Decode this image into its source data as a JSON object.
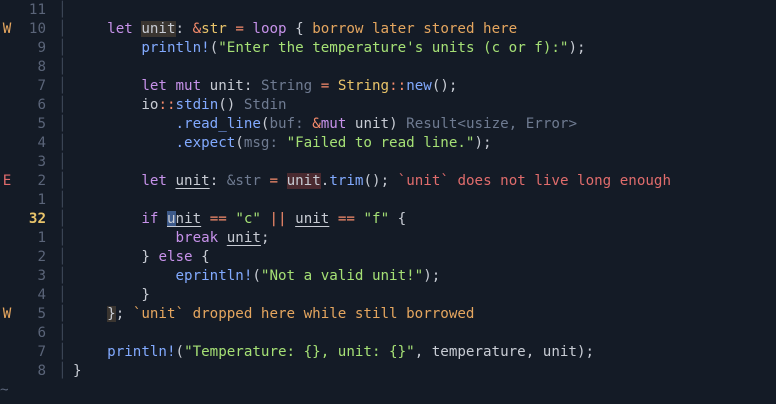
{
  "editor": {
    "lines": [
      {
        "num": "11",
        "diag": "",
        "cur": false,
        "tokens": []
      },
      {
        "num": "10",
        "diag": "W",
        "cur": false,
        "tokens": [
          {
            "t": "    "
          },
          {
            "t": "let",
            "c": "kw"
          },
          {
            "t": " "
          },
          {
            "t": "unit",
            "c": "var hl-w"
          },
          {
            "t": ": ",
            "c": "punct"
          },
          {
            "t": "&",
            "c": "op"
          },
          {
            "t": "str",
            "c": "ty"
          },
          {
            "t": " "
          },
          {
            "t": "=",
            "c": "op"
          },
          {
            "t": " "
          },
          {
            "t": "loop",
            "c": "kw"
          },
          {
            "t": " { ",
            "c": "punct"
          },
          {
            "t": "borrow later stored here",
            "c": "warn"
          }
        ]
      },
      {
        "num": "9",
        "diag": "",
        "cur": false,
        "tokens": [
          {
            "t": "        "
          },
          {
            "t": "println!",
            "c": "fn"
          },
          {
            "t": "(",
            "c": "punct"
          },
          {
            "t": "\"Enter the temperature's units (c or f):\"",
            "c": "str"
          },
          {
            "t": ");",
            "c": "punct"
          }
        ]
      },
      {
        "num": "8",
        "diag": "",
        "cur": false,
        "tokens": []
      },
      {
        "num": "7",
        "diag": "",
        "cur": false,
        "tokens": [
          {
            "t": "        "
          },
          {
            "t": "let",
            "c": "kw"
          },
          {
            "t": " "
          },
          {
            "t": "mut",
            "c": "kw"
          },
          {
            "t": " unit",
            "c": "var"
          },
          {
            "t": ": ",
            "c": "punct"
          },
          {
            "t": "String",
            "c": "hint"
          },
          {
            "t": " "
          },
          {
            "t": "=",
            "c": "op"
          },
          {
            "t": " "
          },
          {
            "t": "String",
            "c": "ty"
          },
          {
            "t": "::",
            "c": "op"
          },
          {
            "t": "new",
            "c": "fn"
          },
          {
            "t": "();",
            "c": "punct"
          }
        ]
      },
      {
        "num": "6",
        "diag": "",
        "cur": false,
        "tokens": [
          {
            "t": "        "
          },
          {
            "t": "io",
            "c": "var"
          },
          {
            "t": "::",
            "c": "op"
          },
          {
            "t": "stdin",
            "c": "fn"
          },
          {
            "t": "() ",
            "c": "punct"
          },
          {
            "t": "Stdin",
            "c": "hint"
          }
        ]
      },
      {
        "num": "5",
        "diag": "",
        "cur": false,
        "tokens": [
          {
            "t": "            "
          },
          {
            "t": ".read_line",
            "c": "fn"
          },
          {
            "t": "(",
            "c": "punct"
          },
          {
            "t": "buf: ",
            "c": "hint"
          },
          {
            "t": "&",
            "c": "op"
          },
          {
            "t": "mut",
            "c": "kw"
          },
          {
            "t": " unit",
            "c": "var"
          },
          {
            "t": ") ",
            "c": "punct"
          },
          {
            "t": "Result<usize, Error>",
            "c": "hint"
          }
        ]
      },
      {
        "num": "4",
        "diag": "",
        "cur": false,
        "tokens": [
          {
            "t": "            "
          },
          {
            "t": ".expect",
            "c": "fn"
          },
          {
            "t": "(",
            "c": "punct"
          },
          {
            "t": "msg: ",
            "c": "hint"
          },
          {
            "t": "\"Failed to read line.\"",
            "c": "str"
          },
          {
            "t": ");",
            "c": "punct"
          }
        ]
      },
      {
        "num": "3",
        "diag": "",
        "cur": false,
        "tokens": []
      },
      {
        "num": "2",
        "diag": "E",
        "cur": false,
        "tokens": [
          {
            "t": "        "
          },
          {
            "t": "let",
            "c": "kw"
          },
          {
            "t": " "
          },
          {
            "t": "unit",
            "c": "var ul"
          },
          {
            "t": ": ",
            "c": "punct"
          },
          {
            "t": "&str",
            "c": "hint"
          },
          {
            "t": " "
          },
          {
            "t": "=",
            "c": "op"
          },
          {
            "t": " "
          },
          {
            "t": "unit",
            "c": "var hl-e"
          },
          {
            "t": ".",
            "c": "punct"
          },
          {
            "t": "trim",
            "c": "fn"
          },
          {
            "t": "(); ",
            "c": "punct"
          },
          {
            "t": "`unit` does not live long enough",
            "c": "err"
          }
        ]
      },
      {
        "num": "1",
        "diag": "",
        "cur": false,
        "tokens": []
      },
      {
        "num": "32",
        "diag": "",
        "cur": true,
        "tokens": [
          {
            "t": "        "
          },
          {
            "t": "if",
            "c": "kw"
          },
          {
            "t": " "
          },
          {
            "t": "u",
            "c": "var cursor ul"
          },
          {
            "t": "nit",
            "c": "var ul"
          },
          {
            "t": " "
          },
          {
            "t": "==",
            "c": "op"
          },
          {
            "t": " "
          },
          {
            "t": "\"c\"",
            "c": "str"
          },
          {
            "t": " "
          },
          {
            "t": "||",
            "c": "op"
          },
          {
            "t": " "
          },
          {
            "t": "unit",
            "c": "var ul"
          },
          {
            "t": " "
          },
          {
            "t": "==",
            "c": "op"
          },
          {
            "t": " "
          },
          {
            "t": "\"f\"",
            "c": "str"
          },
          {
            "t": " {",
            "c": "punct"
          }
        ]
      },
      {
        "num": "1",
        "diag": "",
        "cur": false,
        "tokens": [
          {
            "t": "            "
          },
          {
            "t": "break",
            "c": "kw"
          },
          {
            "t": " "
          },
          {
            "t": "unit",
            "c": "var ul"
          },
          {
            "t": ";",
            "c": "punct"
          }
        ]
      },
      {
        "num": "2",
        "diag": "",
        "cur": false,
        "tokens": [
          {
            "t": "        "
          },
          {
            "t": "} ",
            "c": "punct"
          },
          {
            "t": "else",
            "c": "kw"
          },
          {
            "t": " {",
            "c": "punct"
          }
        ]
      },
      {
        "num": "3",
        "diag": "",
        "cur": false,
        "tokens": [
          {
            "t": "            "
          },
          {
            "t": "eprintln!",
            "c": "fn"
          },
          {
            "t": "(",
            "c": "punct"
          },
          {
            "t": "\"Not a valid unit!\"",
            "c": "str"
          },
          {
            "t": ");",
            "c": "punct"
          }
        ]
      },
      {
        "num": "4",
        "diag": "",
        "cur": false,
        "tokens": [
          {
            "t": "        "
          },
          {
            "t": "}",
            "c": "punct"
          }
        ]
      },
      {
        "num": "5",
        "diag": "W",
        "cur": false,
        "tokens": [
          {
            "t": "    "
          },
          {
            "t": "}",
            "c": "punct hl-w"
          },
          {
            "t": "; ",
            "c": "punct"
          },
          {
            "t": "`unit` dropped here while still borrowed",
            "c": "warn"
          }
        ]
      },
      {
        "num": "6",
        "diag": "",
        "cur": false,
        "tokens": []
      },
      {
        "num": "7",
        "diag": "",
        "cur": false,
        "tokens": [
          {
            "t": "    "
          },
          {
            "t": "println!",
            "c": "fn"
          },
          {
            "t": "(",
            "c": "punct"
          },
          {
            "t": "\"Temperature: {}, unit: {}\"",
            "c": "str"
          },
          {
            "t": ", temperature, unit);",
            "c": "punct"
          }
        ]
      },
      {
        "num": "8",
        "diag": "",
        "cur": false,
        "tokens": [
          {
            "t": "}",
            "c": "punct"
          }
        ]
      }
    ],
    "tilde": "~"
  }
}
